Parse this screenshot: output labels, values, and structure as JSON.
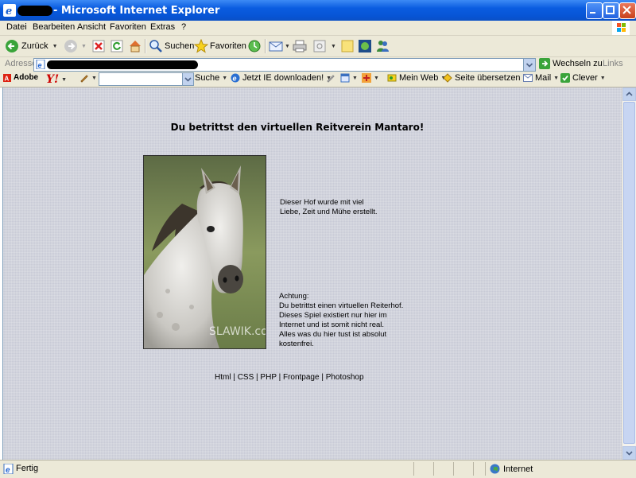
{
  "window": {
    "title": "- Microsoft Internet Explorer"
  },
  "menu": {
    "items": [
      "Datei",
      "Bearbeiten",
      "Ansicht",
      "Favoriten",
      "Extras",
      "?"
    ]
  },
  "toolbar": {
    "back_label": "Zurück",
    "search_label": "Suchen",
    "favorites_label": "Favoriten"
  },
  "address": {
    "label": "Adresse",
    "go_label": "Wechseln zu",
    "links_label": "Links"
  },
  "ytoolbar": {
    "adobe_label": "Adobe",
    "search_btn": "Suche",
    "ie_download": "Jetzt IE downloaden!",
    "myweb": "Mein Web",
    "translate": "Seite übersetzen",
    "mail": "Mail",
    "clever": "Clever"
  },
  "page": {
    "heading": "Du betrittst den virtuellen Reitverein Mantaro!",
    "watermark": "SLAWIK.com",
    "text1": [
      "Dieser Hof wurde mit viel",
      "Liebe, Zeit und Mühe erstellt."
    ],
    "text2": [
      "Achtung:",
      "Du betrittst einen virtuellen Reiterhof.",
      "Dieses Spiel existiert nur hier im",
      "Internet und ist somit nicht real.",
      "Alles was du hier tust ist absolut",
      "kostenfrei."
    ],
    "footer": "Html | CSS | PHP | Frontpage | Photoshop"
  },
  "status": {
    "left": "Fertig",
    "zone": "Internet"
  }
}
